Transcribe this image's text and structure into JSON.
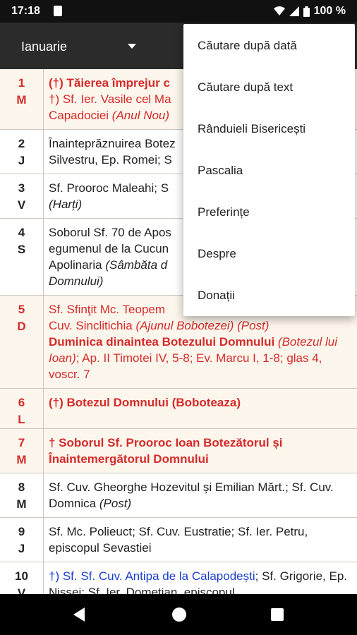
{
  "status": {
    "time": "17:18",
    "battery": "100 %"
  },
  "appbar": {
    "month": "Ianuarie"
  },
  "menu": {
    "items": [
      "Căutare după dată",
      "Căutare după text",
      "Rânduieli Bisericești",
      "Pascalia",
      "Preferințe",
      "Despre",
      "Donații"
    ]
  },
  "days": [
    {
      "num": "1",
      "wd": "M",
      "red": true,
      "hl": true,
      "parts": [
        {
          "text": "(†) Tăierea împrejur c",
          "cls": "b"
        },
        {
          "br": true
        },
        {
          "text": "†) Sf. Ier. Vasile cel Ma"
        },
        {
          "br": true
        },
        {
          "text": "Capadociei "
        },
        {
          "text": "(Anul Nou)",
          "cls": "i"
        }
      ]
    },
    {
      "num": "2",
      "wd": "J",
      "red": false,
      "hl": false,
      "parts": [
        {
          "text": "Înainteprăznuirea Botez"
        },
        {
          "br": true
        },
        {
          "text": "Silvestru, Ep. Romei; S"
        }
      ]
    },
    {
      "num": "3",
      "wd": "V",
      "red": false,
      "hl": false,
      "parts": [
        {
          "text": "Sf. Prooroc Maleahi; S"
        },
        {
          "br": true
        },
        {
          "text": "(Harți)",
          "cls": "i"
        }
      ]
    },
    {
      "num": "4",
      "wd": "S",
      "red": false,
      "hl": false,
      "parts": [
        {
          "text": "Soborul Sf. 70 de Apos"
        },
        {
          "br": true
        },
        {
          "text": "egumenul de la Cucun"
        },
        {
          "br": true
        },
        {
          "text": "Apolinaria "
        },
        {
          "text": "(Sâmbăta d",
          "cls": "i"
        },
        {
          "br": true
        },
        {
          "text": "Domnului)",
          "cls": "i"
        }
      ]
    },
    {
      "num": "5",
      "wd": "D",
      "red": true,
      "hl": true,
      "parts": [
        {
          "text": "Sf. Sfinţit Mc. Teopem"
        },
        {
          "br": true
        },
        {
          "text": "Cuv. Sinclitichia "
        },
        {
          "text": "(Ajunul Bobotezei) (Post)",
          "cls": "i"
        },
        {
          "br": true
        },
        {
          "text": "Duminica dinaintea Botezului Domnului",
          "cls": "b"
        },
        {
          "text": " (Botezul lui Ioan)",
          "cls": "i"
        },
        {
          "text": "; Ap. II Timotei IV, 5-8; Ev. Marcu I, 1-8; glas 4, voscr. 7"
        }
      ]
    },
    {
      "num": "6",
      "wd": "L",
      "red": true,
      "hl": true,
      "parts": [
        {
          "text": "(†) Botezul Domnului (Boboteaza)",
          "cls": "b"
        }
      ]
    },
    {
      "num": "7",
      "wd": "M",
      "red": true,
      "hl": true,
      "parts": [
        {
          "text": "† Soborul Sf. Prooroc Ioan Botezătorul și Înaintemergătorul Domnului",
          "cls": "b"
        }
      ]
    },
    {
      "num": "8",
      "wd": "M",
      "red": false,
      "hl": false,
      "parts": [
        {
          "text": "Sf. Cuv. Gheorghe Hozevitul și Emilian Mărt.; Sf. Cuv. Domnica "
        },
        {
          "text": "(Post)",
          "cls": "i"
        }
      ]
    },
    {
      "num": "9",
      "wd": "J",
      "red": false,
      "hl": false,
      "parts": [
        {
          "text": "Sf. Mc. Polieuct; Sf. Cuv. Eustratie; Sf. Ier. Petru, episcopul Sevastiei"
        }
      ]
    },
    {
      "num": "10",
      "wd": "V",
      "red": false,
      "hl": false,
      "parts": [
        {
          "text": "†) Sf. Sf. Cuv. Antipa de la Calapodești",
          "cls": "blue"
        },
        {
          "text": "; Sf. Grigorie, Ep. Nissei; Sf. Ier. Dometian, episcopul"
        }
      ]
    }
  ]
}
